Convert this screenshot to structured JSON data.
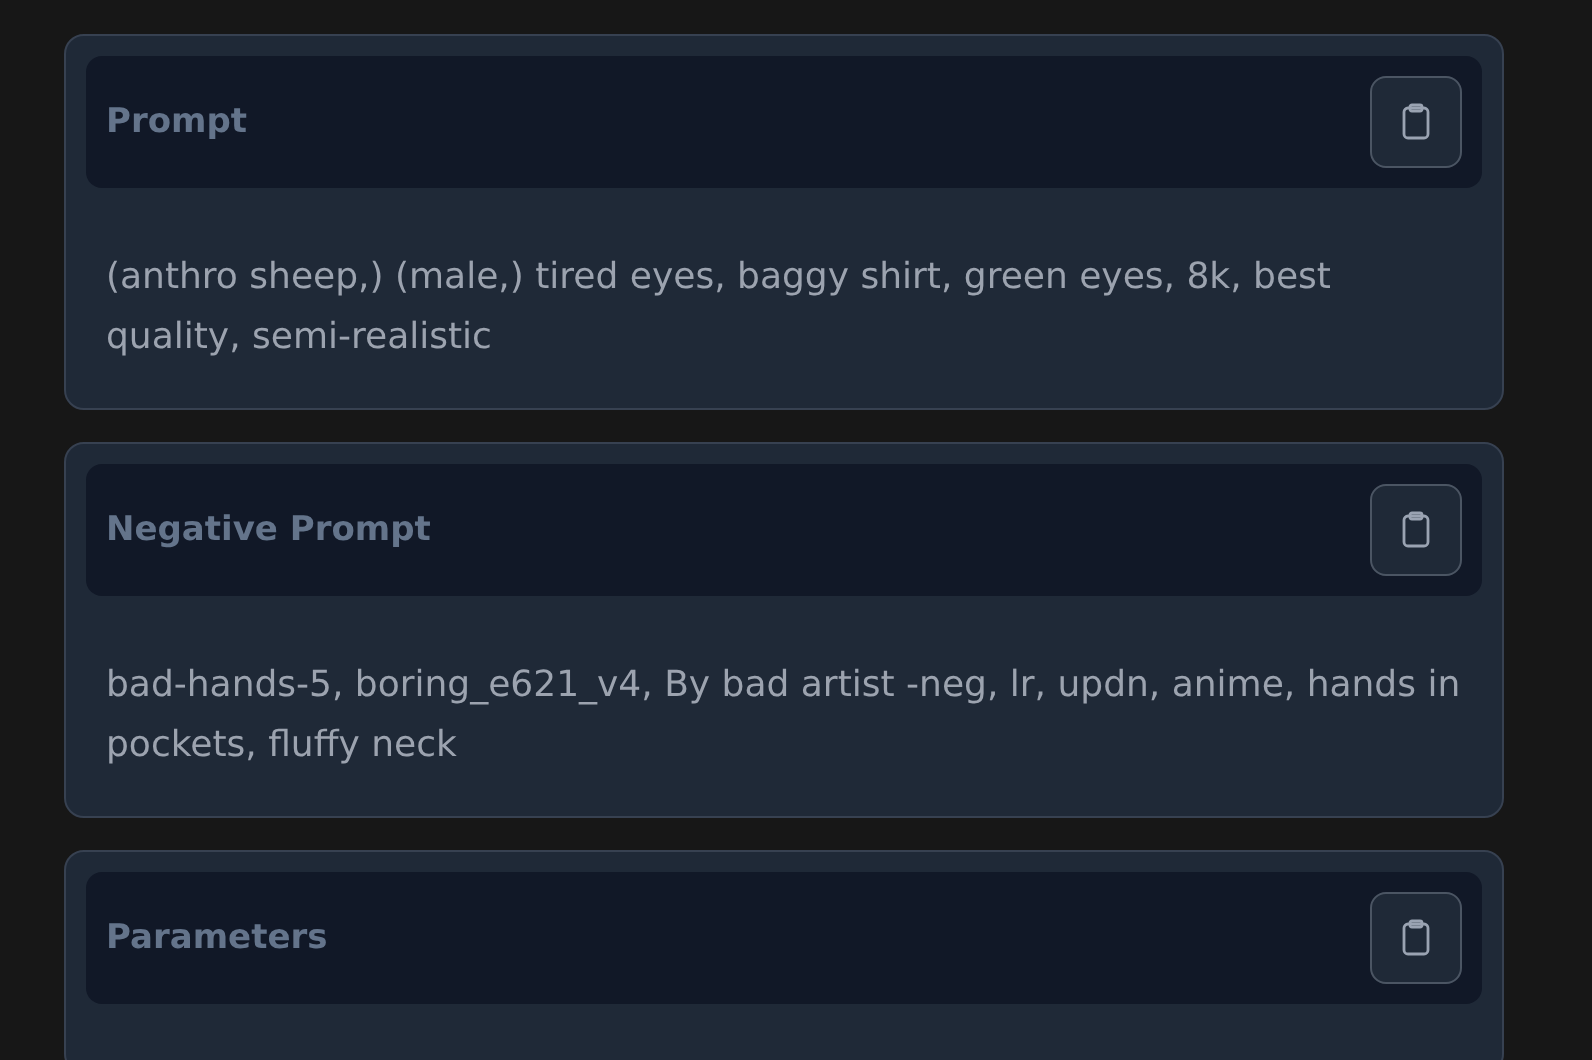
{
  "sections": [
    {
      "title": "Prompt",
      "text": "(anthro sheep,) (male,) tired eyes, baggy shirt, green eyes, 8k, best quality, semi-realistic"
    },
    {
      "title": "Negative Prompt",
      "text": "bad-hands-5, boring_e621_v4, By bad artist -neg, lr, updn, anime, hands in pockets, fluffy neck"
    },
    {
      "title": "Parameters"
    }
  ]
}
